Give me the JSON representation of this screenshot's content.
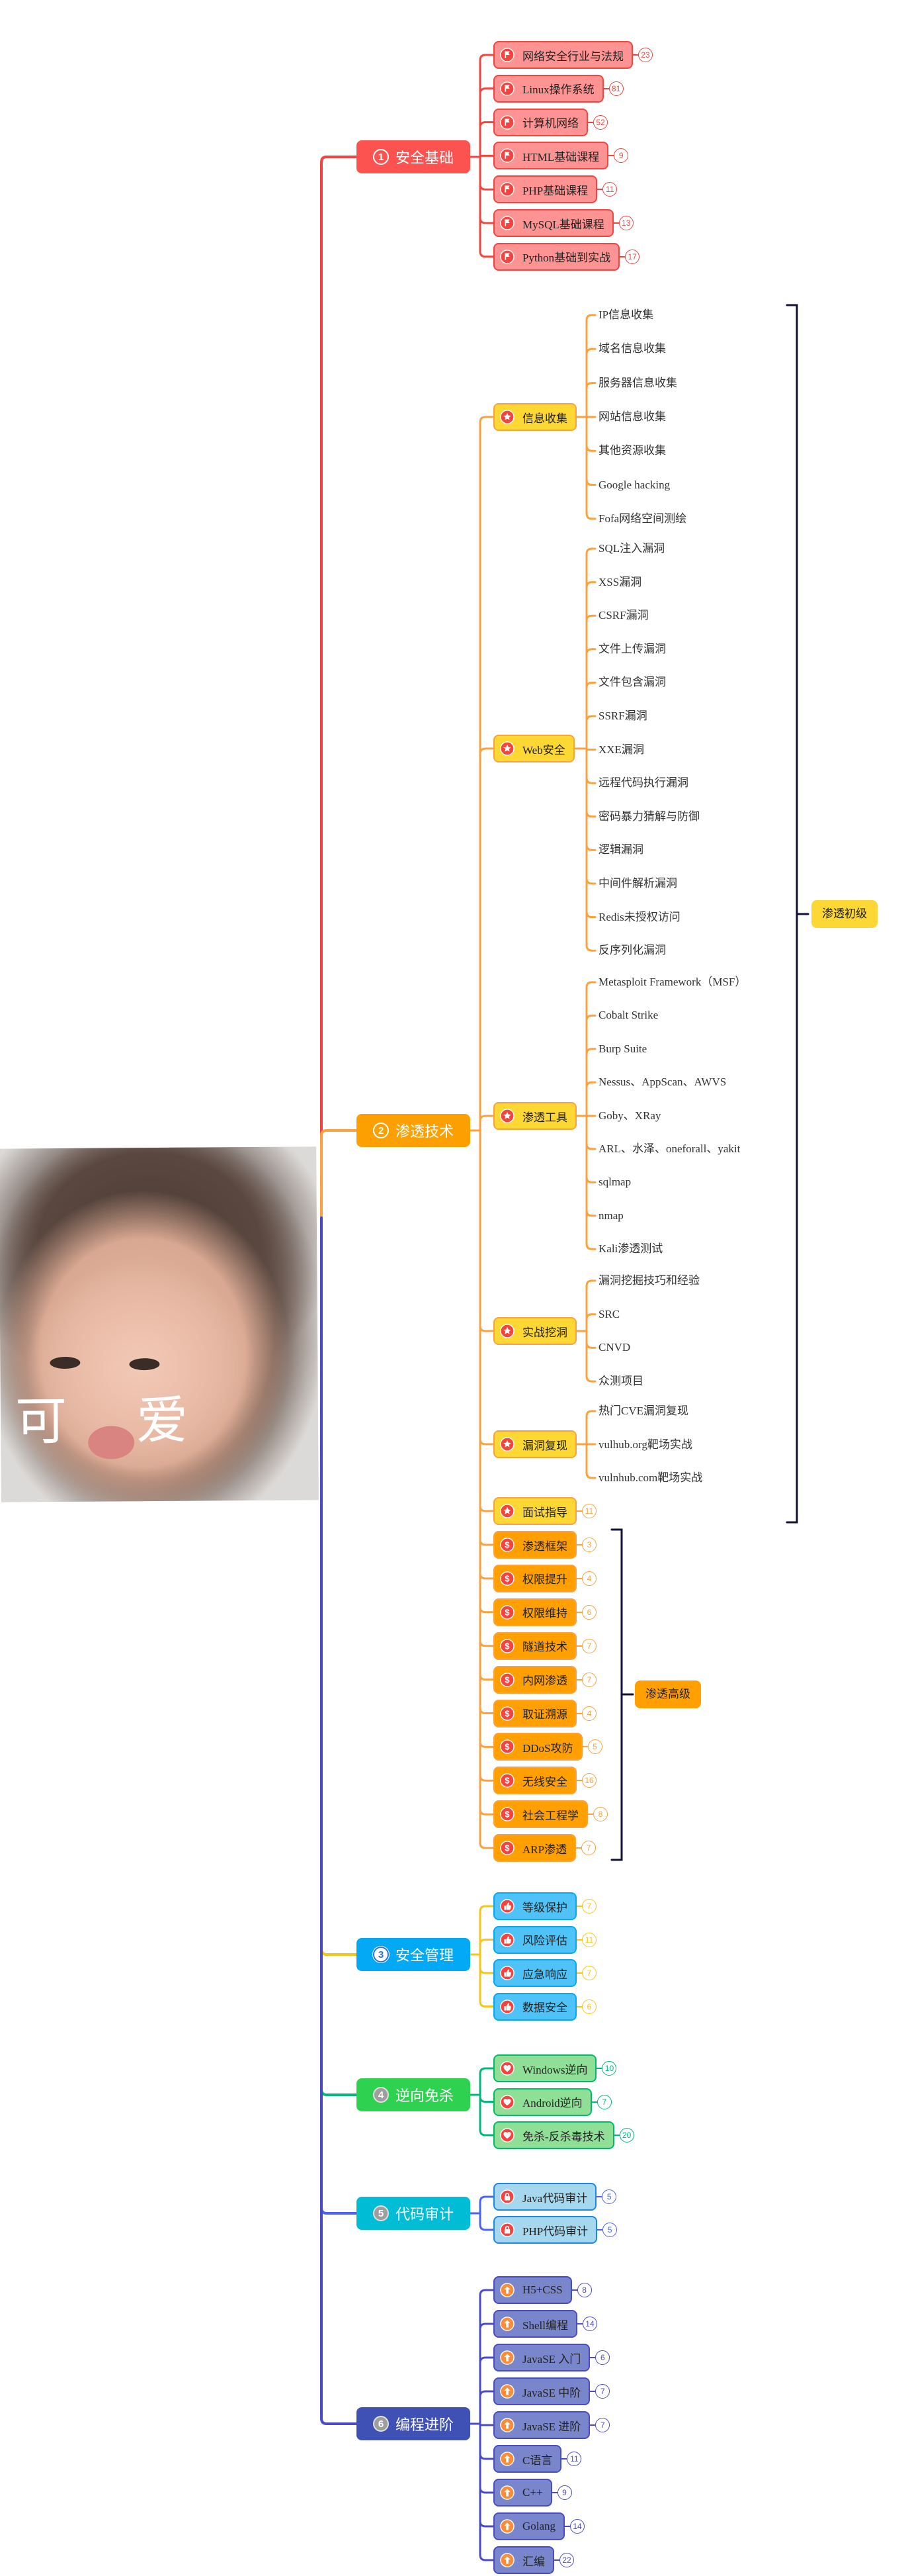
{
  "sections": [
    {
      "number": "1",
      "label": "安全基础",
      "badge": "outline",
      "node_color": "#fd5350",
      "line_color": "#f5443f",
      "box_fill": "#fd9493",
      "box_border": "#f5443f",
      "count_color": "#f5443f",
      "icon": "flag",
      "icon_color": "#f5443f",
      "children": [
        {
          "label": "网络安全行业与法规",
          "count": "23"
        },
        {
          "label": "Linux操作系统",
          "count": "81"
        },
        {
          "label": "计算机网络",
          "count": "52"
        },
        {
          "label": "HTML基础课程",
          "count": "9"
        },
        {
          "label": "PHP基础课程",
          "count": "11"
        },
        {
          "label": "MySQL基础课程",
          "count": "13"
        },
        {
          "label": "Python基础到实战",
          "count": "17"
        }
      ]
    },
    {
      "number": "2",
      "label": "渗透技术",
      "badge": "outline",
      "node_color": "#fc9f00",
      "line_color": "#f9a23f",
      "box_border": "#f9a23f",
      "count_color": "#f9a23f",
      "children": [
        {
          "label": "信息收集",
          "icon": "star",
          "fill": "#fdd835",
          "leaves": [
            "IP信息收集",
            "域名信息收集",
            "服务器信息收集",
            "网站信息收集",
            "其他资源收集",
            "Google hacking",
            "Fofa网络空间测绘"
          ]
        },
        {
          "label": "Web安全",
          "icon": "star",
          "fill": "#fdd835",
          "leaves": [
            "SQL注入漏洞",
            "XSS漏洞",
            "CSRF漏洞",
            "文件上传漏洞",
            "文件包含漏洞",
            "SSRF漏洞",
            "XXE漏洞",
            "远程代码执行漏洞",
            "密码暴力猜解与防御",
            "逻辑漏洞",
            "中间件解析漏洞",
            "Redis未授权访问",
            "反序列化漏洞"
          ]
        },
        {
          "label": "渗透工具",
          "icon": "star",
          "fill": "#fdd835",
          "leaves": [
            "Metasploit Framework（MSF）",
            "Cobalt Strike",
            "Burp Suite",
            "Nessus、AppScan、AWVS",
            "Goby、XRay",
            "ARL、水泽、oneforall、yakit",
            "sqlmap",
            "nmap",
            "Kali渗透测试"
          ]
        },
        {
          "label": "实战挖洞",
          "icon": "star",
          "fill": "#fdd835",
          "leaves": [
            "漏洞挖掘技巧和经验",
            "SRC",
            "CNVD",
            "众测项目"
          ]
        },
        {
          "label": "漏洞复现",
          "icon": "star",
          "fill": "#fdd835",
          "leaves": [
            "热门CVE漏洞复现",
            "vulhub.org靶场实战",
            "vulnhub.com靶场实战"
          ]
        },
        {
          "label": "面试指导",
          "icon": "star",
          "fill": "#fdd835",
          "count": "11"
        },
        {
          "label": "渗透框架",
          "icon": "dollar",
          "fill": "#ff9f00",
          "count": "3"
        },
        {
          "label": "权限提升",
          "icon": "dollar",
          "fill": "#ff9f00",
          "count": "4"
        },
        {
          "label": "权限维持",
          "icon": "dollar",
          "fill": "#ff9f00",
          "count": "6"
        },
        {
          "label": "隧道技术",
          "icon": "dollar",
          "fill": "#ff9f00",
          "count": "7"
        },
        {
          "label": "内网渗透",
          "icon": "dollar",
          "fill": "#ff9f00",
          "count": "7"
        },
        {
          "label": "取证溯源",
          "icon": "dollar",
          "fill": "#ff9f00",
          "count": "4"
        },
        {
          "label": "DDoS攻防",
          "icon": "dollar",
          "fill": "#ff9f00",
          "count": "5"
        },
        {
          "label": "无线安全",
          "icon": "dollar",
          "fill": "#ff9f00",
          "count": "16"
        },
        {
          "label": "社会工程学",
          "icon": "dollar",
          "fill": "#ff9f00",
          "count": "8"
        },
        {
          "label": "ARP渗透",
          "icon": "dollar",
          "fill": "#ff9f00",
          "count": "7"
        }
      ]
    },
    {
      "number": "3",
      "label": "安全管理",
      "badge": "blue",
      "node_color": "#03a9f4",
      "line_color": "#f5c518",
      "box_fill": "#4fc3f7",
      "box_border": "#03a9f4",
      "count_color": "#f5c518",
      "icon": "thumbs-up",
      "icon_color": "#f5443f",
      "children": [
        {
          "label": "等级保护",
          "count": "7"
        },
        {
          "label": "风险评估",
          "count": "11"
        },
        {
          "label": "应急响应",
          "count": "7"
        },
        {
          "label": "数据安全",
          "count": "6"
        }
      ]
    },
    {
      "number": "4",
      "label": "逆向免杀",
      "badge": "gray",
      "node_color": "#2fd150",
      "line_color": "#00b87a",
      "box_fill": "#8fdf97",
      "box_border": "#00b96b",
      "count_color": "#00b87a",
      "icon": "heart",
      "icon_color": "#f5443f",
      "children": [
        {
          "label": "Windows逆向",
          "count": "10"
        },
        {
          "label": "Android逆向",
          "count": "7"
        },
        {
          "label": "免杀-反杀毒技术",
          "count": "20"
        }
      ]
    },
    {
      "number": "5",
      "label": "代码审计",
      "badge": "gray",
      "node_color": "#00bcd4",
      "line_color": "#4a63f5",
      "box_fill": "#a5d8ef",
      "box_border": "#1e88e5",
      "count_color": "#4a63f5",
      "icon": "lock",
      "icon_color": "#f5443f",
      "children": [
        {
          "label": "Java代码审计",
          "count": "5"
        },
        {
          "label": "PHP代码审计",
          "count": "5"
        }
      ]
    },
    {
      "number": "6",
      "label": "编程进阶",
      "badge": "gray",
      "node_color": "#3f51b5",
      "line_color": "#4b4bc8",
      "box_fill": "#7986cb",
      "box_border": "#4b4bc8",
      "count_color": "#4b4bc8",
      "icon": "arrow-up",
      "icon_color": "#fb8c3a",
      "children": [
        {
          "label": "H5+CSS",
          "count": "8"
        },
        {
          "label": "Shell编程",
          "count": "14"
        },
        {
          "label": "JavaSE 入门",
          "count": "6"
        },
        {
          "label": "JavaSE 中阶",
          "count": "7"
        },
        {
          "label": "JavaSE 进阶",
          "count": "7"
        },
        {
          "label": "C语言",
          "count": "11"
        },
        {
          "label": "C++",
          "count": "9"
        },
        {
          "label": "Golang",
          "count": "14"
        },
        {
          "label": "汇编",
          "count": "22"
        }
      ]
    }
  ],
  "brackets": [
    {
      "label": "渗透初级",
      "color": "#fdd835",
      "line_color": "#12123a"
    },
    {
      "label": "渗透高级",
      "color": "#ff9f00",
      "line_color": "#12123a"
    }
  ],
  "image": {
    "caption_left": "可",
    "caption_right": "爱"
  }
}
